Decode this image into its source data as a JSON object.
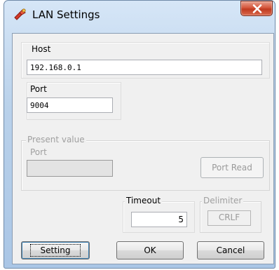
{
  "window": {
    "title": "LAN Settings",
    "icon": "network-tool-icon",
    "close_label": "close"
  },
  "host": {
    "group_label": "Host",
    "value": "192.168.0.1"
  },
  "port": {
    "group_label": "Port",
    "value": "9004"
  },
  "present_value": {
    "group_label": "Present value",
    "port_label": "Port",
    "port_value": "",
    "read_button": "Port Read"
  },
  "timeout": {
    "label": "Timeout",
    "value": "5"
  },
  "delimiter": {
    "label": "Delimiter",
    "value": "CRLF"
  },
  "buttons": {
    "setting": "Setting",
    "ok": "OK",
    "cancel": "Cancel"
  },
  "colors": {
    "title_bar": "#b9d1ea",
    "close_button": "#d5573d",
    "dialog_bg": "#f0f0f0",
    "disabled_text": "#a0a0a0"
  }
}
